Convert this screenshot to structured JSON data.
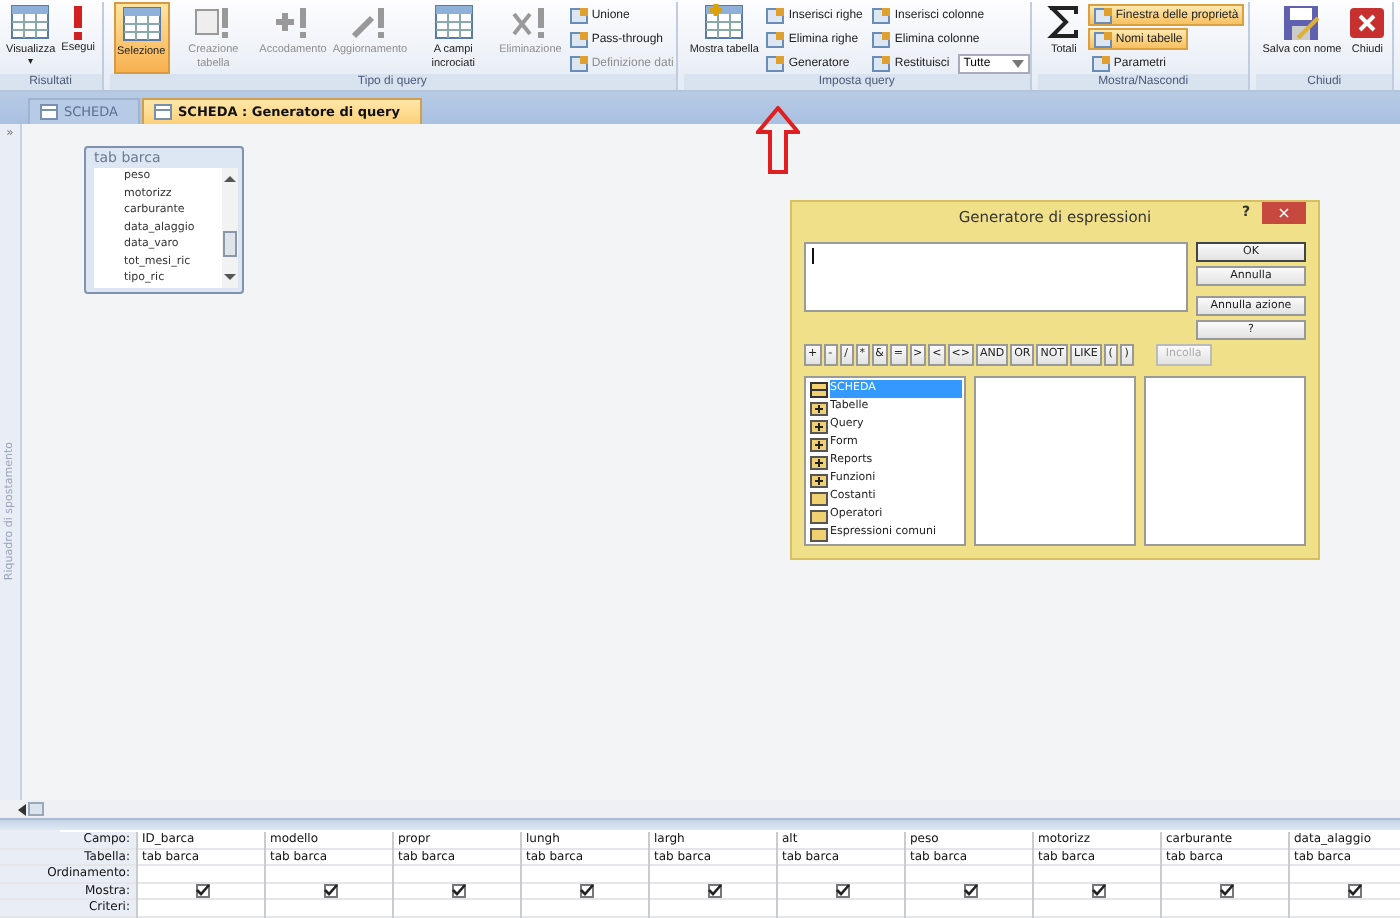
{
  "ribbon": {
    "groups": [
      {
        "label": "Risultati",
        "large": [
          {
            "label": "Visualizza",
            "dropdown": "▾",
            "selected": false,
            "disabled": false
          },
          {
            "label": "Esegui",
            "selected": false,
            "disabled": false
          }
        ]
      },
      {
        "label": "Tipo di query",
        "large": [
          {
            "label": "Selezione",
            "selected": true,
            "disabled": false
          },
          {
            "label": "Creazione tabella",
            "selected": false,
            "disabled": true
          },
          {
            "label": "Accodamento",
            "selected": false,
            "disabled": true
          },
          {
            "label": "Aggiornamento",
            "selected": false,
            "disabled": true
          },
          {
            "label": "A campi incrociati",
            "selected": false,
            "disabled": false
          },
          {
            "label": "Eliminazione",
            "selected": false,
            "disabled": true
          }
        ],
        "small": [
          [
            {
              "label": "Unione",
              "selected": false,
              "disabled": false
            },
            {
              "label": "Pass-through",
              "selected": false,
              "disabled": false
            },
            {
              "label": "Definizione dati",
              "selected": false,
              "disabled": true
            }
          ]
        ]
      },
      {
        "label": "Imposta query",
        "large": [
          {
            "label": "Mostra tabella",
            "selected": false,
            "disabled": false
          }
        ],
        "small": [
          [
            {
              "label": "Inserisci righe",
              "selected": false,
              "disabled": false
            },
            {
              "label": "Elimina righe",
              "selected": false,
              "disabled": false
            },
            {
              "label": "Generatore",
              "selected": false,
              "disabled": false
            }
          ],
          [
            {
              "label": "Inserisci colonne",
              "selected": false,
              "disabled": false
            },
            {
              "label": "Elimina colonne",
              "selected": false,
              "disabled": false
            },
            {
              "label": "Restituisci",
              "selected": false,
              "disabled": false,
              "combo": "Tutte"
            }
          ]
        ]
      },
      {
        "label": "Mostra/Nascondi",
        "large": [
          {
            "label": "Totali",
            "selected": false,
            "disabled": false
          }
        ],
        "small": [
          [
            {
              "label": "Finestra delle proprietà",
              "selected": true,
              "disabled": false
            },
            {
              "label": "Nomi tabelle",
              "selected": true,
              "disabled": false
            },
            {
              "label": "Parametri",
              "selected": false,
              "disabled": false
            }
          ]
        ]
      },
      {
        "label": "Chiudi",
        "large": [
          {
            "label": "Salva con nome",
            "selected": false,
            "disabled": false
          },
          {
            "label": "Chiudi",
            "selected": false,
            "disabled": false
          }
        ]
      }
    ]
  },
  "navigation_pane": {
    "toggle": "»",
    "title": "Riquadro di spostamento"
  },
  "document_tabs": [
    {
      "label": "SCHEDA",
      "selected": false
    },
    {
      "label": "SCHEDA : Generatore di query",
      "selected": true
    }
  ],
  "table_box": {
    "title": "tab barca",
    "fields": [
      "peso",
      "motorizz",
      "carburante",
      "data_alaggio",
      "data_varo",
      "tot_mesi_ric",
      "tipo_ric"
    ]
  },
  "dialog": {
    "title": "Generatore di espressioni",
    "help": "?",
    "close": "×",
    "buttons": [
      "OK",
      "Annulla",
      "Annulla azione",
      "?"
    ],
    "operators": [
      {
        "label": "+",
        "disabled": false
      },
      {
        "label": "-",
        "disabled": false
      },
      {
        "label": "/",
        "disabled": false
      },
      {
        "label": "*",
        "disabled": false
      },
      {
        "label": "&",
        "disabled": false
      },
      {
        "label": "=",
        "disabled": false
      },
      {
        "label": ">",
        "disabled": false
      },
      {
        "label": "<",
        "disabled": false
      },
      {
        "label": "<>",
        "disabled": false
      },
      {
        "label": "AND",
        "disabled": false
      },
      {
        "label": "OR",
        "disabled": false
      },
      {
        "label": "NOT",
        "disabled": false
      },
      {
        "label": "LIKE",
        "disabled": false
      },
      {
        "label": "(",
        "disabled": false
      },
      {
        "label": ")",
        "disabled": false
      },
      {
        "label": "Incolla",
        "disabled": true
      }
    ],
    "tree": [
      {
        "label": "SCHEDA",
        "kind": "open",
        "selected": true
      },
      {
        "label": "Tabelle",
        "kind": "expandable",
        "selected": false
      },
      {
        "label": "Query",
        "kind": "expandable",
        "selected": false
      },
      {
        "label": "Form",
        "kind": "expandable",
        "selected": false
      },
      {
        "label": "Reports",
        "kind": "expandable",
        "selected": false
      },
      {
        "label": "Funzioni",
        "kind": "expandable",
        "selected": false
      },
      {
        "label": "Costanti",
        "kind": "folder",
        "selected": false
      },
      {
        "label": "Operatori",
        "kind": "folder",
        "selected": false
      },
      {
        "label": "Espressioni comuni",
        "kind": "folder",
        "selected": false
      }
    ]
  },
  "design_grid": {
    "row_labels": [
      "Campo:",
      "Tabella:",
      "Ordinamento:",
      "Mostra:",
      "Criteri:"
    ],
    "columns": [
      {
        "field": "ID_barca",
        "table": "tab barca",
        "show": true
      },
      {
        "field": "modello",
        "table": "tab barca",
        "show": true
      },
      {
        "field": "propr",
        "table": "tab barca",
        "show": true
      },
      {
        "field": "lungh",
        "table": "tab barca",
        "show": true
      },
      {
        "field": "largh",
        "table": "tab barca",
        "show": true
      },
      {
        "field": "alt",
        "table": "tab barca",
        "show": true
      },
      {
        "field": "peso",
        "table": "tab barca",
        "show": true
      },
      {
        "field": "motorizz",
        "table": "tab barca",
        "show": true
      },
      {
        "field": "carburante",
        "table": "tab barca",
        "show": true
      },
      {
        "field": "data_alaggio",
        "table": "tab barca",
        "show": true
      }
    ]
  }
}
